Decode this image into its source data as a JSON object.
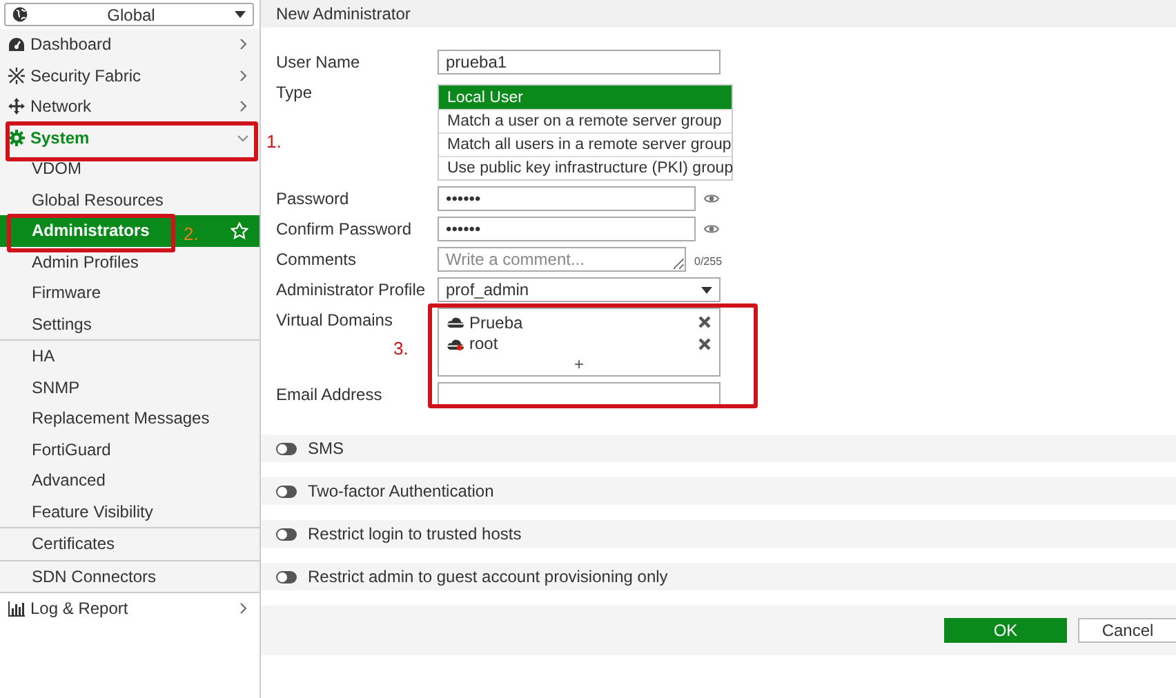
{
  "scope_selector": {
    "label": "Global"
  },
  "sidebar": {
    "items": [
      {
        "label": "Dashboard",
        "expanded": false
      },
      {
        "label": "Security Fabric",
        "expanded": false
      },
      {
        "label": "Network",
        "expanded": false
      },
      {
        "label": "System",
        "expanded": true,
        "child_groups": [
          {
            "items": [
              {
                "label": "VDOM",
                "selected": false
              },
              {
                "label": "Global Resources",
                "selected": false
              },
              {
                "label": "Administrators",
                "selected": true
              },
              {
                "label": "Admin Profiles",
                "selected": false
              },
              {
                "label": "Firmware",
                "selected": false
              },
              {
                "label": "Settings",
                "selected": false
              }
            ]
          },
          {
            "items": [
              {
                "label": "HA",
                "selected": false
              },
              {
                "label": "SNMP",
                "selected": false
              },
              {
                "label": "Replacement Messages",
                "selected": false
              },
              {
                "label": "FortiGuard",
                "selected": false
              },
              {
                "label": "Advanced",
                "selected": false
              },
              {
                "label": "Feature Visibility",
                "selected": false
              }
            ]
          },
          {
            "items": [
              {
                "label": "Certificates",
                "selected": false
              }
            ]
          },
          {
            "items": [
              {
                "label": "SDN Connectors",
                "selected": false
              }
            ]
          }
        ]
      },
      {
        "label": "Log & Report",
        "expanded": false
      }
    ]
  },
  "page": {
    "title": "New Administrator"
  },
  "form": {
    "user_name": {
      "label": "User Name",
      "value": "prueba1"
    },
    "type": {
      "label": "Type",
      "options": [
        {
          "label": "Local User",
          "selected": true
        },
        {
          "label": "Match a user on a remote server group",
          "selected": false
        },
        {
          "label": "Match all users in a remote server group",
          "selected": false
        },
        {
          "label": "Use public key infrastructure (PKI) group",
          "selected": false
        }
      ]
    },
    "password": {
      "label": "Password",
      "value": "••••••"
    },
    "confirm_password": {
      "label": "Confirm Password",
      "value": "••••••"
    },
    "comments": {
      "label": "Comments",
      "placeholder": "Write a comment...",
      "counter": "0/255"
    },
    "administrator_profile": {
      "label": "Administrator Profile",
      "value": "prof_admin"
    },
    "virtual_domains": {
      "label": "Virtual Domains",
      "entries": [
        {
          "name": "Prueba"
        },
        {
          "name": "root"
        }
      ],
      "add": "+"
    },
    "email_address": {
      "label": "Email Address"
    }
  },
  "toggles": [
    {
      "label": "SMS",
      "on": false
    },
    {
      "label": "Two-factor Authentication",
      "on": false
    },
    {
      "label": "Restrict login to trusted hosts",
      "on": false
    },
    {
      "label": "Restrict admin to guest account provisioning only",
      "on": false
    }
  ],
  "buttons": [
    {
      "label": "OK",
      "kind": "primary"
    },
    {
      "label": "Cancel",
      "kind": "secondary"
    }
  ],
  "annotations": [
    {
      "label": "1."
    },
    {
      "label": "2."
    },
    {
      "label": "3."
    }
  ]
}
